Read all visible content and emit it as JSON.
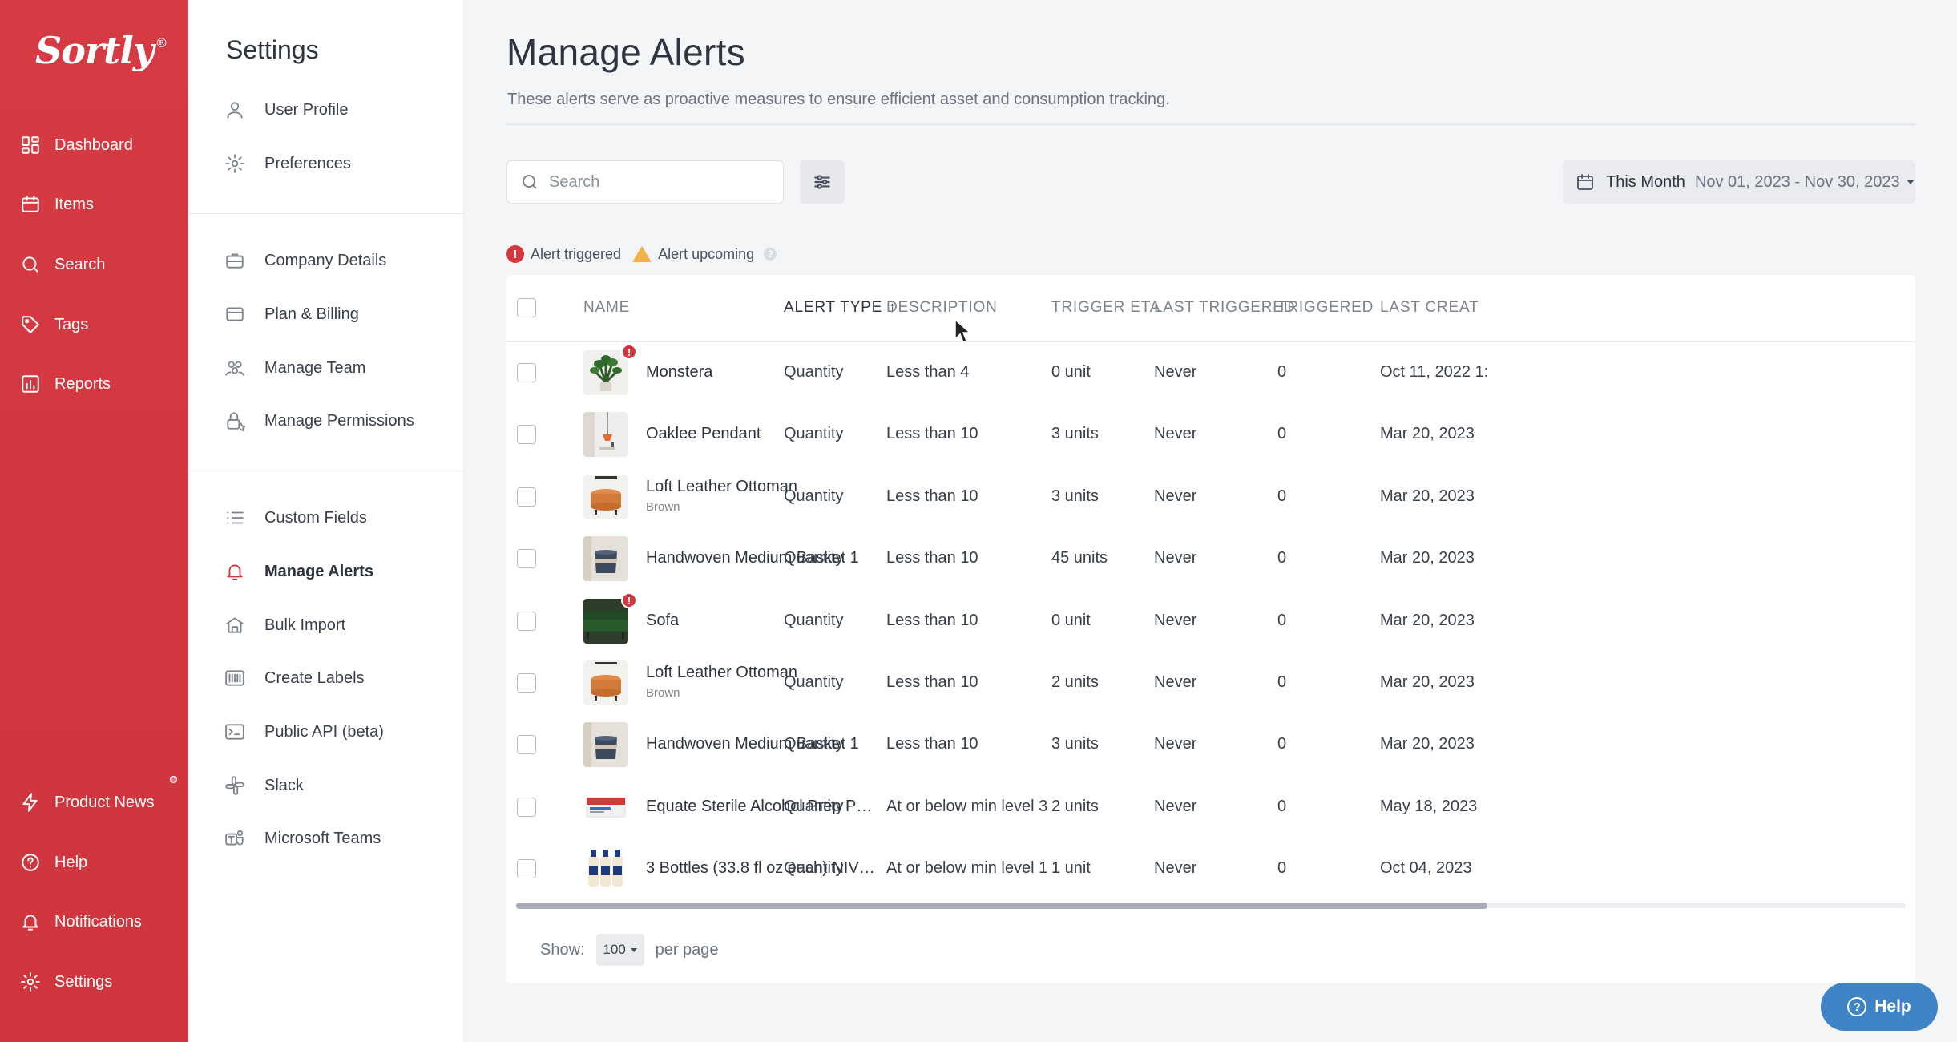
{
  "brand": {
    "logo_text": "Sortly",
    "logo_mark": "®"
  },
  "nav": {
    "top": [
      {
        "label": "Dashboard",
        "icon": "dashboard-icon"
      },
      {
        "label": "Items",
        "icon": "items-icon"
      },
      {
        "label": "Search",
        "icon": "search-icon"
      },
      {
        "label": "Tags",
        "icon": "tag-icon"
      },
      {
        "label": "Reports",
        "icon": "reports-icon"
      }
    ],
    "bottom": [
      {
        "label": "Product News",
        "icon": "bolt-icon"
      },
      {
        "label": "Help",
        "icon": "help-icon"
      },
      {
        "label": "Notifications",
        "icon": "bell-icon"
      },
      {
        "label": "Settings",
        "icon": "gear-icon"
      }
    ]
  },
  "settings": {
    "title": "Settings",
    "groups": [
      [
        {
          "label": "User Profile",
          "icon": "user-icon"
        },
        {
          "label": "Preferences",
          "icon": "gear-icon"
        }
      ],
      [
        {
          "label": "Company Details",
          "icon": "briefcase-icon"
        },
        {
          "label": "Plan & Billing",
          "icon": "credit-card-icon"
        },
        {
          "label": "Manage Team",
          "icon": "team-icon"
        },
        {
          "label": "Manage Permissions",
          "icon": "lock-icon"
        }
      ],
      [
        {
          "label": "Custom Fields",
          "icon": "list-icon"
        },
        {
          "label": "Manage Alerts",
          "icon": "bell-icon",
          "active": true
        },
        {
          "label": "Bulk Import",
          "icon": "import-icon"
        },
        {
          "label": "Create Labels",
          "icon": "barcode-icon"
        },
        {
          "label": "Public API (beta)",
          "icon": "terminal-icon"
        },
        {
          "label": "Slack",
          "icon": "slack-icon"
        },
        {
          "label": "Microsoft Teams",
          "icon": "teams-icon"
        }
      ]
    ]
  },
  "main": {
    "title": "Manage Alerts",
    "subtitle": "These alerts serve as proactive measures to ensure efficient asset and consumption tracking.",
    "search": {
      "placeholder": "Search",
      "value": ""
    },
    "date_filter": {
      "label": "This Month",
      "range": "Nov 01, 2023 - Nov 30, 2023"
    },
    "legend": {
      "triggered": "Alert triggered",
      "upcoming": "Alert upcoming"
    },
    "table": {
      "columns": [
        "NAME",
        "ALERT TYPE",
        "DESCRIPTION",
        "TRIGGER ETA",
        "LAST TRIGGERED",
        "TRIGGERED",
        "LAST CREAT"
      ],
      "sort_column": "ALERT TYPE",
      "sort_dir": "asc",
      "rows": [
        {
          "name": "Monstera",
          "variant": "",
          "triggered_badge": true,
          "thumb": "plant",
          "alert_type": "Quantity",
          "description": "Less than 4",
          "eta": "0 unit",
          "last_triggered": "Never",
          "triggered": "0",
          "last_created": "Oct 11, 2022 1:"
        },
        {
          "name": "Oaklee Pendant",
          "variant": "",
          "triggered_badge": false,
          "thumb": "lamp",
          "alert_type": "Quantity",
          "description": "Less than 10",
          "eta": "3 units",
          "last_triggered": "Never",
          "triggered": "0",
          "last_created": "Mar 20, 2023"
        },
        {
          "name": "Loft Leather Ottoman",
          "variant": "Brown",
          "triggered_badge": false,
          "thumb": "ottoman",
          "alert_type": "Quantity",
          "description": "Less than 10",
          "eta": "3 units",
          "last_triggered": "Never",
          "triggered": "0",
          "last_created": "Mar 20, 2023"
        },
        {
          "name": "Handwoven Medium Basket 1",
          "variant": "",
          "triggered_badge": false,
          "thumb": "basket",
          "alert_type": "Quantity",
          "description": "Less than 10",
          "eta": "45 units",
          "last_triggered": "Never",
          "triggered": "0",
          "last_created": "Mar 20, 2023"
        },
        {
          "name": "Sofa",
          "variant": "",
          "triggered_badge": true,
          "thumb": "sofa",
          "alert_type": "Quantity",
          "description": "Less than 10",
          "eta": "0 unit",
          "last_triggered": "Never",
          "triggered": "0",
          "last_created": "Mar 20, 2023"
        },
        {
          "name": "Loft Leather Ottoman",
          "variant": "Brown",
          "triggered_badge": false,
          "thumb": "ottoman",
          "alert_type": "Quantity",
          "description": "Less than 10",
          "eta": "2 units",
          "last_triggered": "Never",
          "triggered": "0",
          "last_created": "Mar 20, 2023"
        },
        {
          "name": "Handwoven Medium Basket 1",
          "variant": "",
          "triggered_badge": false,
          "thumb": "basket",
          "alert_type": "Quantity",
          "description": "Less than 10",
          "eta": "3 units",
          "last_triggered": "Never",
          "triggered": "0",
          "last_created": "Mar 20, 2023"
        },
        {
          "name": "Equate Sterile Alcohol Prep Pa...",
          "variant": "",
          "triggered_badge": false,
          "thumb": "pads",
          "alert_type": "Quantity",
          "description": "At or below min level 3",
          "eta": "2 units",
          "last_triggered": "Never",
          "triggered": "0",
          "last_created": "May 18, 2023"
        },
        {
          "name": "3 Bottles (33.8 fl oz each) NIVE...",
          "variant": "",
          "triggered_badge": false,
          "thumb": "bottles",
          "alert_type": "Quantity",
          "description": "At or below min level 1",
          "eta": "1 unit",
          "last_triggered": "Never",
          "triggered": "0",
          "last_created": "Oct 04, 2023"
        }
      ]
    },
    "pagination": {
      "show_label": "Show:",
      "per_page_value": "100",
      "per_page_label": "per page"
    }
  },
  "help_button": {
    "label": "Help"
  },
  "colors": {
    "brand_red": "#d2373f",
    "help_blue": "#3f84c6",
    "warning": "#f0b34a"
  }
}
